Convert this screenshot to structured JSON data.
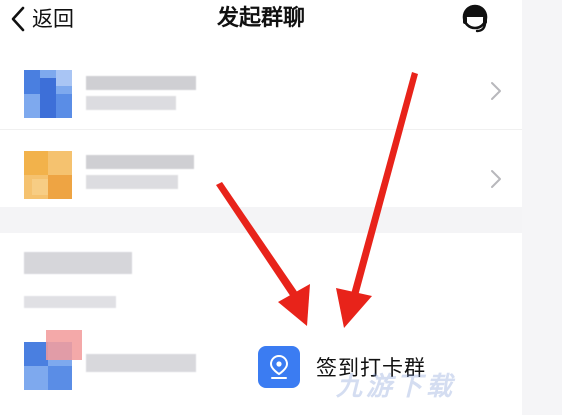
{
  "header": {
    "back_label": "返回",
    "title": "发起群聊"
  },
  "groups": [
    {
      "avatar_color": "#4a7fe0",
      "name": "",
      "subtitle": ""
    },
    {
      "avatar_color": "#f2b24b",
      "name": "",
      "subtitle": ""
    }
  ],
  "checkin_group": {
    "label": "签到打卡群"
  },
  "watermark": "九游下载",
  "colors": {
    "accent": "#3b7cf2",
    "annotation_arrow": "#e8231a"
  },
  "icons": {
    "back": "chevron-left-icon",
    "support": "customer-service-icon",
    "row_chevron": "chevron-right-icon",
    "checkin": "location-pin-icon"
  }
}
